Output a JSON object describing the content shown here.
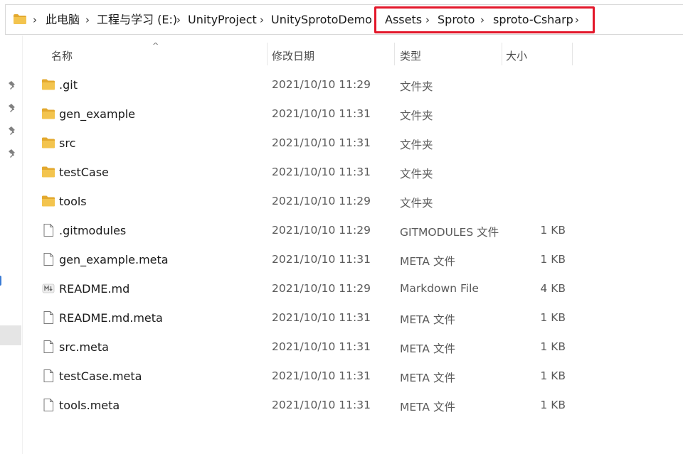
{
  "address_bar": {
    "crumbs": [
      "此电脑",
      "工程与学习 (E:)",
      "UnityProject",
      "UnitySprotoDemo",
      "Assets",
      "Sproto",
      "sproto-Csharp"
    ],
    "separator": "›"
  },
  "columns": {
    "name": "名称",
    "date": "修改日期",
    "type": "类型",
    "size": "大小",
    "sort_indicator": "^"
  },
  "files": [
    {
      "name": ".git",
      "date": "2021/10/10 11:29",
      "type": "文件夹",
      "size": "",
      "icon": "folder-icon"
    },
    {
      "name": "gen_example",
      "date": "2021/10/10 11:31",
      "type": "文件夹",
      "size": "",
      "icon": "folder-icon"
    },
    {
      "name": "src",
      "date": "2021/10/10 11:31",
      "type": "文件夹",
      "size": "",
      "icon": "folder-icon"
    },
    {
      "name": "testCase",
      "date": "2021/10/10 11:31",
      "type": "文件夹",
      "size": "",
      "icon": "folder-icon"
    },
    {
      "name": "tools",
      "date": "2021/10/10 11:29",
      "type": "文件夹",
      "size": "",
      "icon": "folder-icon"
    },
    {
      "name": ".gitmodules",
      "date": "2021/10/10 11:29",
      "type": "GITMODULES 文件",
      "size": "1 KB",
      "icon": "file-icon"
    },
    {
      "name": "gen_example.meta",
      "date": "2021/10/10 11:31",
      "type": "META 文件",
      "size": "1 KB",
      "icon": "file-icon"
    },
    {
      "name": "README.md",
      "date": "2021/10/10 11:29",
      "type": "Markdown File",
      "size": "4 KB",
      "icon": "markdown-file-icon"
    },
    {
      "name": "README.md.meta",
      "date": "2021/10/10 11:31",
      "type": "META 文件",
      "size": "1 KB",
      "icon": "file-icon"
    },
    {
      "name": "src.meta",
      "date": "2021/10/10 11:31",
      "type": "META 文件",
      "size": "1 KB",
      "icon": "file-icon"
    },
    {
      "name": "testCase.meta",
      "date": "2021/10/10 11:31",
      "type": "META 文件",
      "size": "1 KB",
      "icon": "file-icon"
    },
    {
      "name": "tools.meta",
      "date": "2021/10/10 11:31",
      "type": "META 文件",
      "size": "1 KB",
      "icon": "file-icon"
    }
  ],
  "colors": {
    "highlight": "#e3172a",
    "folder": "#f3c44e",
    "folder_dark": "#e3a92f"
  }
}
